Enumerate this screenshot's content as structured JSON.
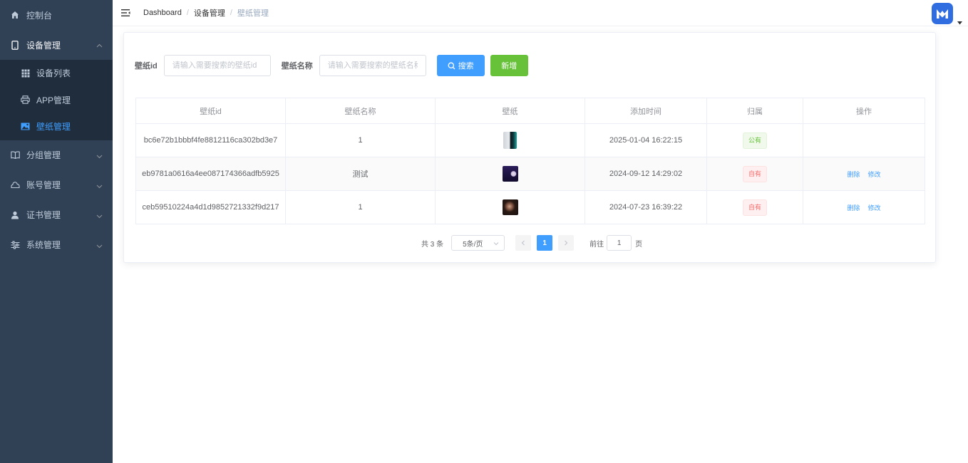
{
  "sidebar": {
    "items": [
      {
        "label": "控制台",
        "icon": "home-icon"
      },
      {
        "label": "设备管理",
        "icon": "tablet-icon"
      },
      {
        "label": "分组管理",
        "icon": "book-icon"
      },
      {
        "label": "账号管理",
        "icon": "cloud-icon"
      },
      {
        "label": "证书管理",
        "icon": "user-icon"
      },
      {
        "label": "系统管理",
        "icon": "sliders-icon"
      }
    ],
    "subitems": [
      {
        "label": "设备列表",
        "icon": "grid-icon"
      },
      {
        "label": "APP管理",
        "icon": "printer-icon"
      },
      {
        "label": "壁纸管理",
        "icon": "image-icon"
      }
    ],
    "colors": {
      "background": "#304156",
      "submenu": "#1f2d3d",
      "active": "#409eff"
    }
  },
  "header": {
    "breadcrumb": [
      "Dashboard",
      "设备管理",
      "壁纸管理"
    ]
  },
  "search": {
    "id_label": "壁纸id",
    "id_placeholder": "请输入需要搜索的壁纸id",
    "name_label": "壁纸名称",
    "name_placeholder": "请输入需要搜索的壁纸名称",
    "search_button": "搜索",
    "add_button": "新增"
  },
  "table": {
    "columns": [
      "壁纸id",
      "壁纸名称",
      "壁纸",
      "添加时间",
      "归属",
      "操作"
    ],
    "rows": [
      {
        "id": "bc6e72b1bbbf4fe8812116ca302bd3e7",
        "name": "1",
        "time": "2025-01-04 16:22:15",
        "owner": "公有",
        "owner_type": "success",
        "actions": []
      },
      {
        "id": "eb9781a0616a4ee087174366adfb5925",
        "name": "测试",
        "time": "2024-09-12 14:29:02",
        "owner": "自有",
        "owner_type": "danger",
        "actions": [
          "删除",
          "修改"
        ]
      },
      {
        "id": "ceb59510224a4d1d9852721332f9d217",
        "name": "1",
        "time": "2024-07-23 16:39:22",
        "owner": "自有",
        "owner_type": "danger",
        "actions": [
          "删除",
          "修改"
        ]
      }
    ]
  },
  "pagination": {
    "total": "共 3 条",
    "page_size": "5条/页",
    "current_page": "1",
    "goto_label": "前往",
    "goto_value": "1",
    "page_unit": "页"
  },
  "colors": {
    "primary": "#409eff",
    "success": "#67c23a",
    "danger": "#f56c6c"
  }
}
